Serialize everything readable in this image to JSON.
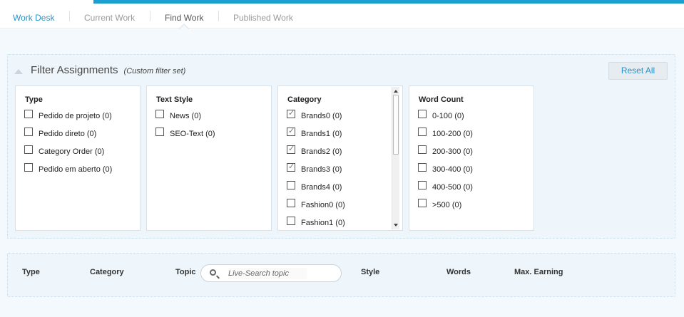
{
  "tabs": [
    {
      "label": "Work Desk"
    },
    {
      "label": "Current Work"
    },
    {
      "label": "Find Work"
    },
    {
      "label": "Published Work"
    }
  ],
  "filter": {
    "title": "Filter Assignments",
    "subtitle": "(Custom filter set)",
    "reset_label": "Reset All",
    "groups": {
      "type": {
        "title": "Type",
        "options": [
          {
            "label": "Pedido de projeto (0)",
            "checked": false
          },
          {
            "label": "Pedido direto (0)",
            "checked": false
          },
          {
            "label": "Category Order (0)",
            "checked": false
          },
          {
            "label": "Pedido em aberto (0)",
            "checked": false
          }
        ]
      },
      "text_style": {
        "title": "Text Style",
        "options": [
          {
            "label": "News (0)",
            "checked": false
          },
          {
            "label": "SEO-Text (0)",
            "checked": false
          }
        ]
      },
      "category": {
        "title": "Category",
        "options": [
          {
            "label": "Brands0 (0)",
            "checked": true
          },
          {
            "label": "Brands1 (0)",
            "checked": true
          },
          {
            "label": "Brands2 (0)",
            "checked": true
          },
          {
            "label": "Brands3 (0)",
            "checked": true
          },
          {
            "label": "Brands4 (0)",
            "checked": false
          },
          {
            "label": "Fashion0 (0)",
            "checked": false
          },
          {
            "label": "Fashion1 (0)",
            "checked": false
          }
        ]
      },
      "word_count": {
        "title": "Word Count",
        "options": [
          {
            "label": "0-100 (0)",
            "checked": false
          },
          {
            "label": "100-200 (0)",
            "checked": false
          },
          {
            "label": "200-300 (0)",
            "checked": false
          },
          {
            "label": "300-400 (0)",
            "checked": false
          },
          {
            "label": "400-500 (0)",
            "checked": false
          },
          {
            "label": ">500 (0)",
            "checked": false
          }
        ]
      }
    }
  },
  "results": {
    "columns": {
      "type": "Type",
      "category": "Category",
      "topic": "Topic",
      "style": "Style",
      "words": "Words",
      "max_earning": "Max. Earning"
    },
    "search_placeholder": "Live-Search topic"
  },
  "colors": {
    "accent": "#1a9fd0",
    "link": "#2a93c7",
    "panel_bg": "#eef6fb"
  }
}
